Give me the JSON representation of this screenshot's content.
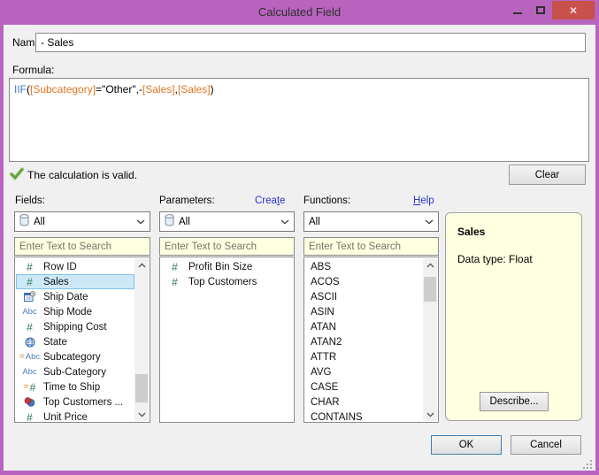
{
  "window": {
    "title": "Calculated Field",
    "close_glyph": "✕"
  },
  "name_row": {
    "label": "Name:",
    "value": "- Sales"
  },
  "formula": {
    "label": "Formula:",
    "text": "IIF([Subcategory]=\"Other\",-[Sales],[Sales])",
    "tokens": [
      {
        "t": "IIF",
        "c": "keyword"
      },
      {
        "t": "(",
        "c": "plain"
      },
      {
        "t": "[Subcategory]",
        "c": "field"
      },
      {
        "t": "=\"Other\",-",
        "c": "plain"
      },
      {
        "t": "[Sales]",
        "c": "field"
      },
      {
        "t": ",",
        "c": "plain"
      },
      {
        "t": "[Sales]",
        "c": "field"
      },
      {
        "t": ")",
        "c": "plain"
      }
    ]
  },
  "status": {
    "message": "The calculation is valid.",
    "clear_label": "Clear"
  },
  "fields": {
    "label": "Fields:",
    "filter": "All",
    "search_placeholder": "Enter Text to Search",
    "items": [
      {
        "icon": "number",
        "label": "Row ID"
      },
      {
        "icon": "number",
        "label": "Sales",
        "selected": true
      },
      {
        "icon": "date",
        "label": "Ship Date"
      },
      {
        "icon": "abc",
        "label": "Ship Mode"
      },
      {
        "icon": "number",
        "label": "Shipping Cost"
      },
      {
        "icon": "globe",
        "label": "State"
      },
      {
        "icon": "calc-abc",
        "label": "Subcategory"
      },
      {
        "icon": "abc",
        "label": "Sub-Category"
      },
      {
        "icon": "calc-number",
        "label": "Time to Ship"
      },
      {
        "icon": "sets",
        "label": "Top Customers ..."
      },
      {
        "icon": "number",
        "label": "Unit Price"
      }
    ]
  },
  "parameters": {
    "label": "Parameters:",
    "link": {
      "pre": "Crea",
      "accel": "t",
      "post": "e"
    },
    "filter": "All",
    "search_placeholder": "Enter Text to Search",
    "items": [
      {
        "icon": "number",
        "label": "Profit Bin Size"
      },
      {
        "icon": "number",
        "label": "Top Customers"
      }
    ]
  },
  "functions": {
    "label": "Functions:",
    "link": {
      "pre": "",
      "accel": "H",
      "post": "elp"
    },
    "filter": "All",
    "search_placeholder": "Enter Text to Search",
    "items": [
      "ABS",
      "ACOS",
      "ASCII",
      "ASIN",
      "ATAN",
      "ATAN2",
      "ATTR",
      "AVG",
      "CASE",
      "CHAR",
      "CONTAINS"
    ]
  },
  "detail": {
    "title": "Sales",
    "info": "Data type: Float",
    "describe_label": "Describe..."
  },
  "footer": {
    "ok": "OK",
    "cancel": "Cancel"
  },
  "colors": {
    "titlebar": "#b864be",
    "close_button": "#c9514b",
    "selection_bg": "#cde9f7",
    "selection_border": "#7fc3e8",
    "link": "#2736cc",
    "number_icon_green": "#28794e",
    "string_icon_blue": "#4e7cbb",
    "calc_icon_orange": "#e0751f",
    "syntax_keyword_blue": "#3f7bc1",
    "syntax_field_orange": "#dd7622",
    "search_bg": "#ffffe1",
    "panel_bg": "#ffffe1"
  }
}
